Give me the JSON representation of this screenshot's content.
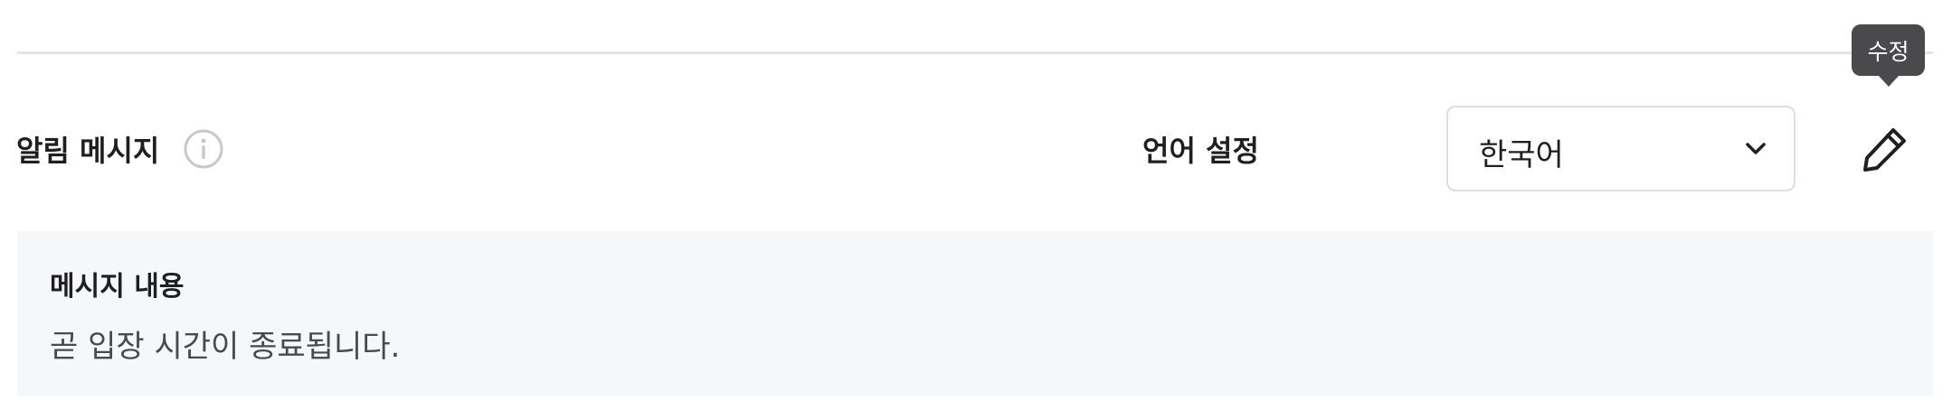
{
  "tooltip": {
    "text": "수정"
  },
  "alert": {
    "label": "알림 메시지",
    "info_icon": "info-circle-icon"
  },
  "language": {
    "label": "언어 설정",
    "selected": "한국어",
    "dropdown_icon": "chevron-down-icon"
  },
  "edit": {
    "icon": "pencil-icon"
  },
  "message": {
    "heading": "메시지 내용",
    "body": "곧 입장 시간이 종료됩니다."
  },
  "colors": {
    "tooltip_bg": "#4a4a4c",
    "panel_bg": "#f6f7f9",
    "divider": "#e5e5e7",
    "text_primary": "#1f1f1f",
    "text_secondary": "#4a4a4a",
    "icon_muted": "#c8c8cc"
  }
}
